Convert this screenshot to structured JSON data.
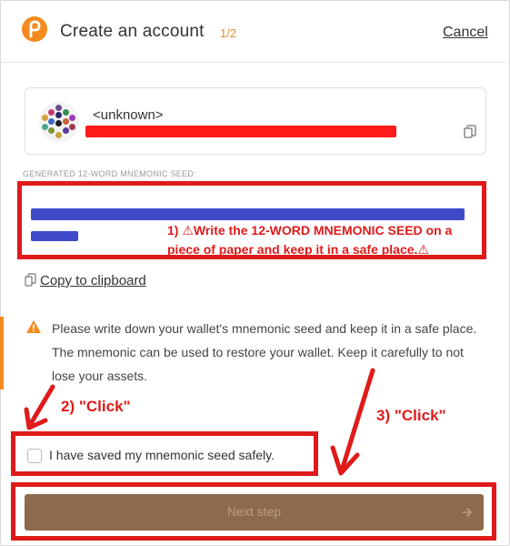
{
  "header": {
    "title": "Create an account",
    "step": "1/2",
    "cancel_label": "Cancel"
  },
  "account": {
    "name": "<unknown>"
  },
  "seed": {
    "label": "GENERATED 12-WORD MNEMONIC SEED:",
    "annotation": "1) ⚠Write the 12-WORD MNEMONIC SEED on a piece of paper and keep it in a safe place.⚠"
  },
  "copy_clipboard_label": "Copy to clipboard",
  "warning": {
    "text": "Please write down your wallet's mnemonic seed and keep it in a safe place. The mnemonic can be used to restore your wallet. Keep it carefully to not lose your assets."
  },
  "callouts": {
    "click_2": "2) \"Click\"",
    "click_3": "3) \"Click\""
  },
  "checkbox_label": "I have saved my mnemonic seed safely.",
  "next_label": "Next step",
  "colors": {
    "accent": "#f58a1f",
    "annotation_red": "#e01a1a",
    "button_brown": "#8c6a4b",
    "redaction_blue": "#3f49c9"
  }
}
